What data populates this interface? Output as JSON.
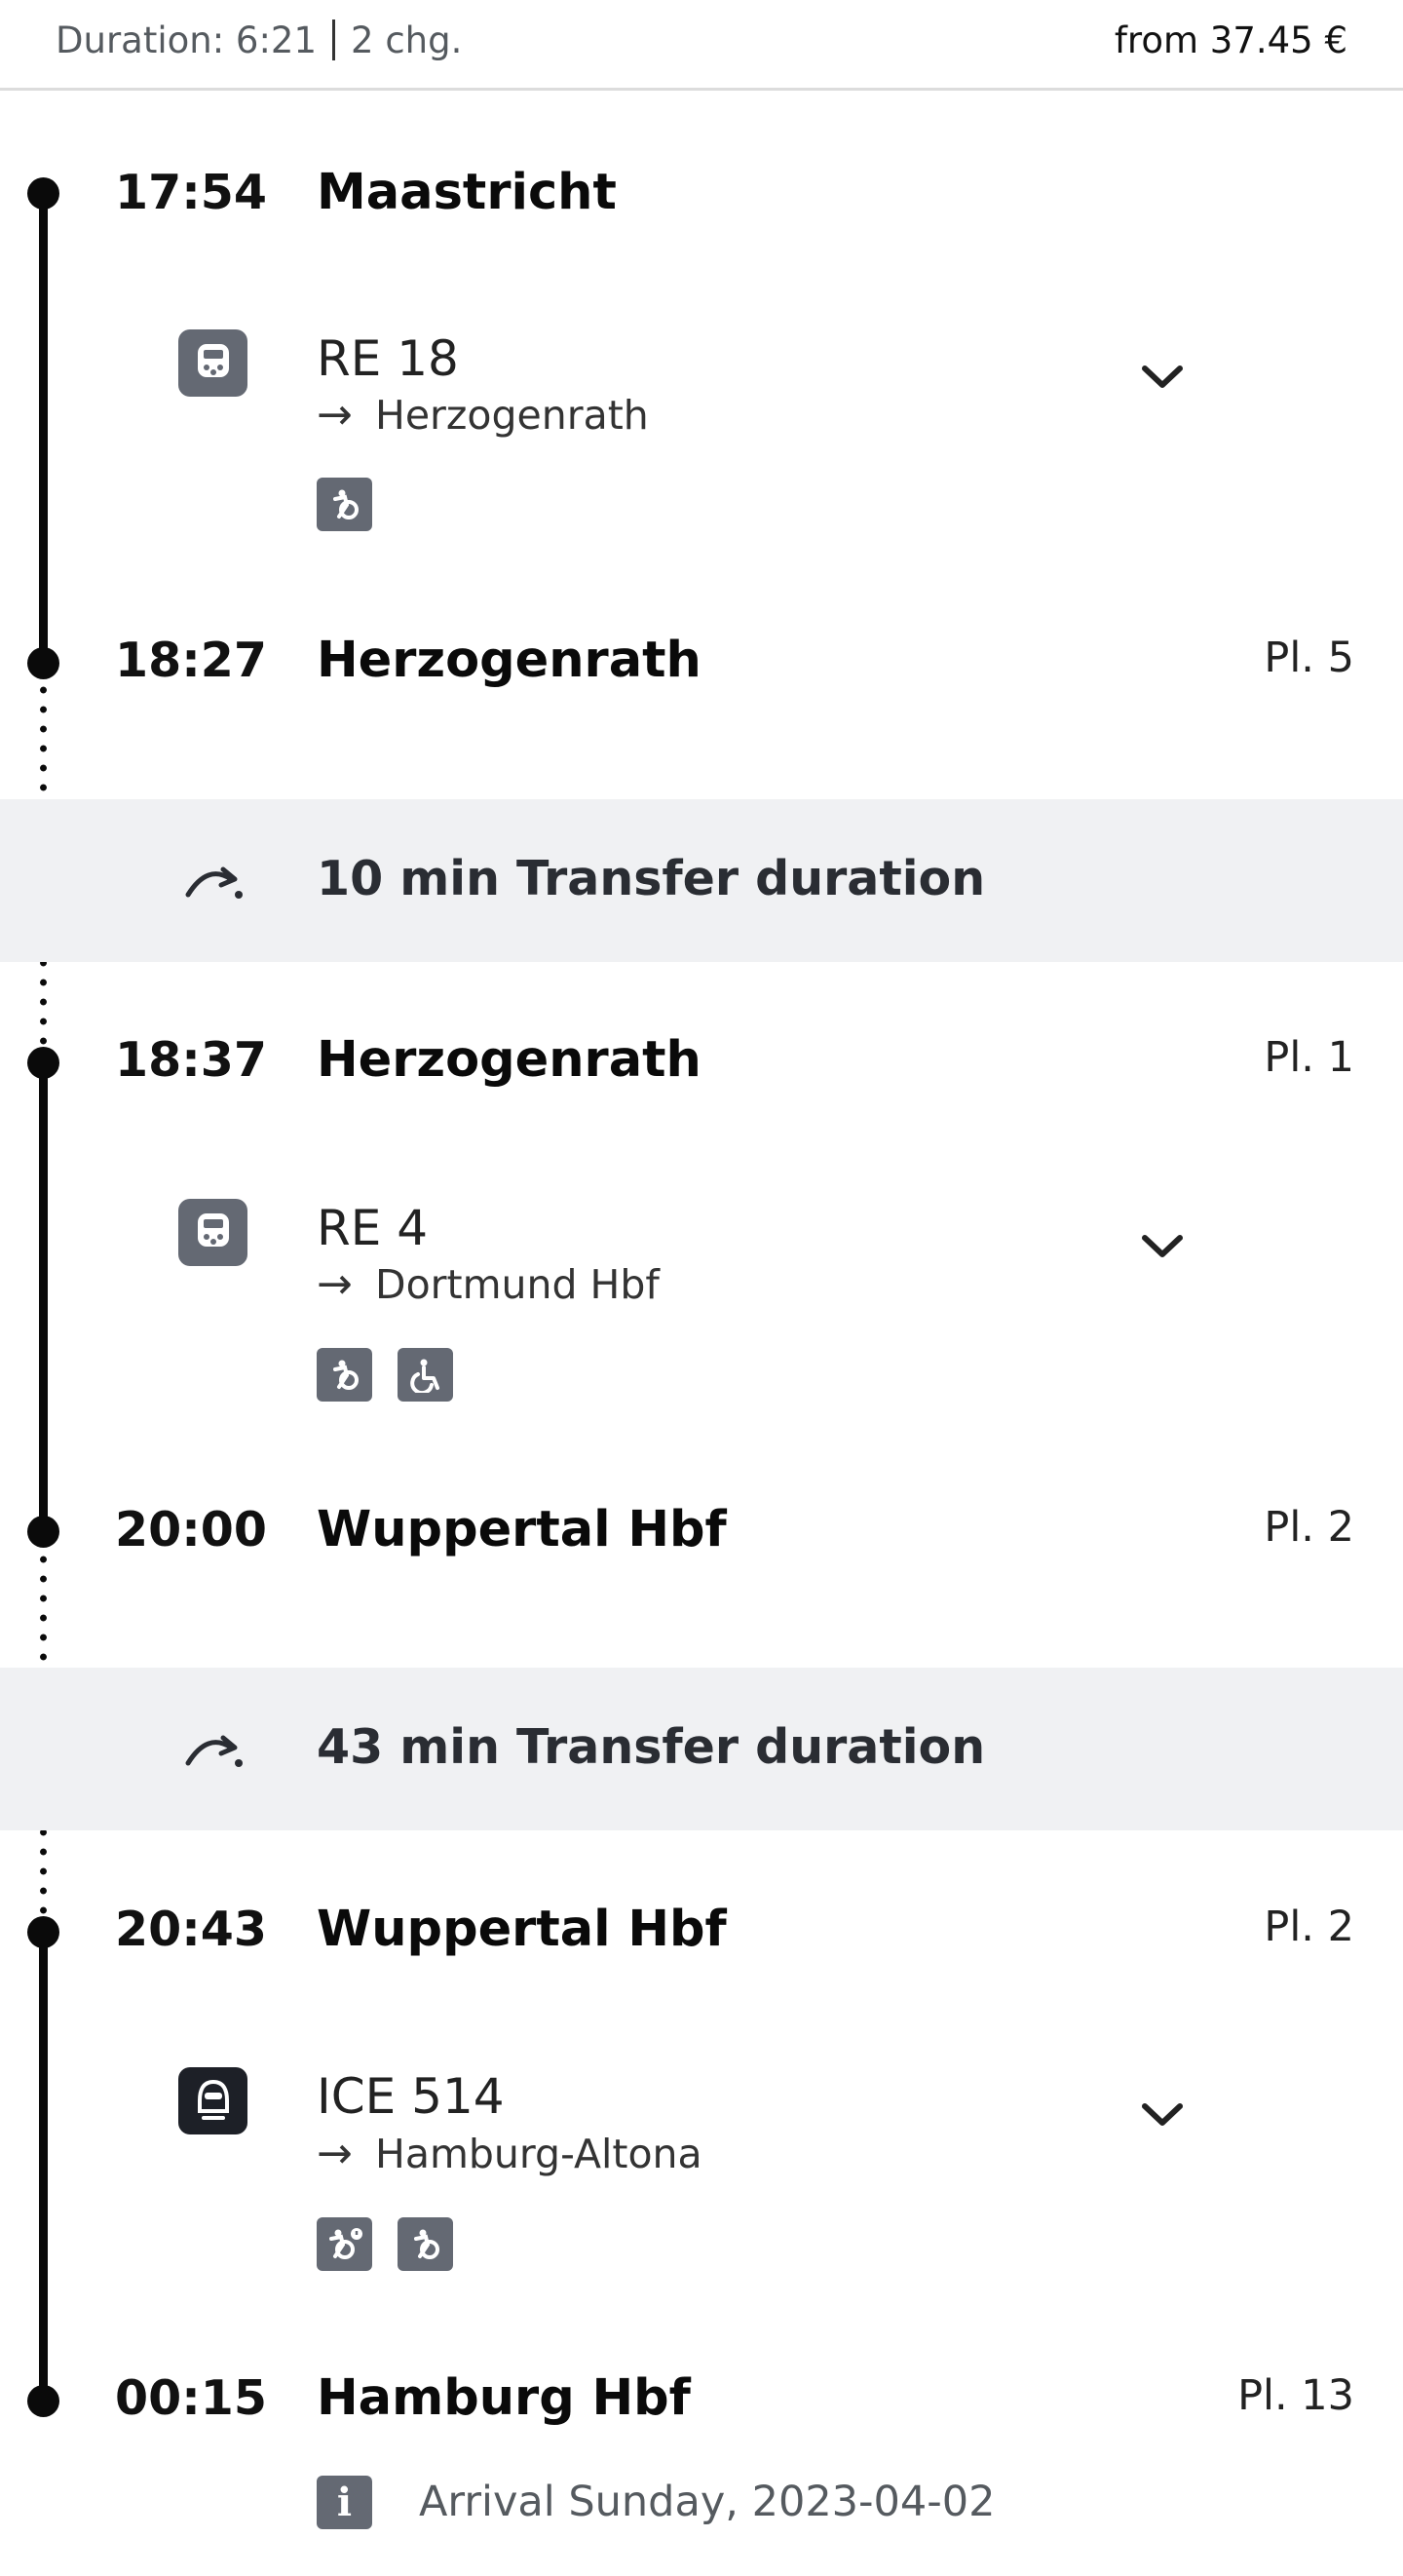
{
  "summary": {
    "duration": "Duration: 6:21",
    "changes": "2 chg.",
    "price": "from 37.45 €"
  },
  "stops": [
    {
      "time": "17:54",
      "station": "Maastricht",
      "platform": ""
    },
    {
      "time": "18:27",
      "station": "Herzogenrath",
      "platform": "Pl. 5"
    },
    {
      "time": "18:37",
      "station": "Herzogenrath",
      "platform": "Pl. 1"
    },
    {
      "time": "20:00",
      "station": "Wuppertal Hbf",
      "platform": "Pl. 2"
    },
    {
      "time": "20:43",
      "station": "Wuppertal Hbf",
      "platform": "Pl. 2"
    },
    {
      "time": "00:15",
      "station": "Hamburg Hbf",
      "platform": "Pl. 13"
    }
  ],
  "legs": [
    {
      "train": "RE 18",
      "destination": "Herzogenrath",
      "icon": "regional-train-icon",
      "badges": [
        "bicycle-icon"
      ]
    },
    {
      "train": "RE 4",
      "destination": "Dortmund Hbf",
      "icon": "regional-train-icon",
      "badges": [
        "bicycle-icon",
        "wheelchair-icon"
      ]
    },
    {
      "train": "ICE 514",
      "destination": "Hamburg-Altona",
      "icon": "ice-train-icon",
      "badges": [
        "bicycle-reservation-icon",
        "bicycle-icon"
      ]
    }
  ],
  "transfers": [
    {
      "text": "10 min Transfer duration"
    },
    {
      "text": "43 min Transfer duration"
    }
  ],
  "footer": {
    "info": "Arrival Sunday, 2023-04-02"
  },
  "colors": {
    "timeline": "#0a0a0a",
    "icon_gray": "#646973",
    "ice_dark": "#1d2027",
    "transfer_bg": "#f0f1f3"
  }
}
